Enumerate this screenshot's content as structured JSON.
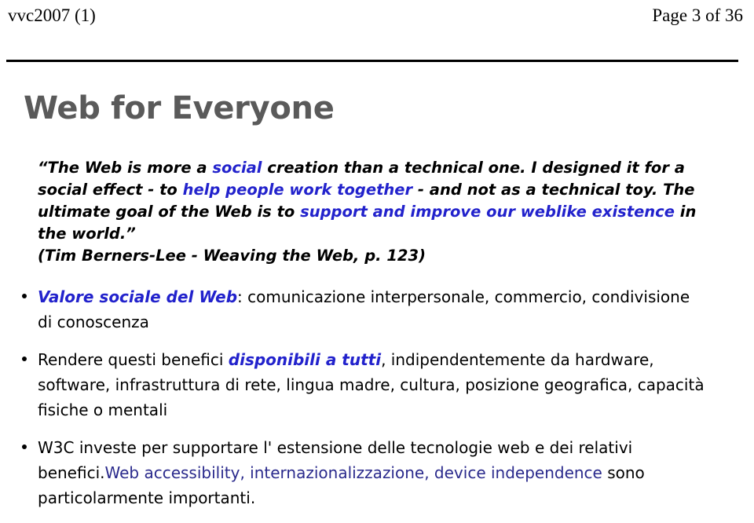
{
  "header": {
    "doc_id": "vvc2007 (1)",
    "page_label": "Page 3 of 36"
  },
  "slide": {
    "title": "Web for Everyone",
    "quote": {
      "seg1": "“The Web is more a ",
      "seg2_blue": "social",
      "seg3": " creation than a technical one. I designed it for a social effect - to ",
      "seg4_blue": "help people work together",
      "seg5": " - and not as a technical toy. The ultimate goal of the Web is to ",
      "seg6_blue": "support and improve our weblike existence",
      "seg7": " in the world.”",
      "attribution": "(Tim Berners-Lee - Weaving the Web, p. 123)"
    },
    "bullets": [
      {
        "lead_blue": "Valore sociale del Web",
        "rest": ": comunicazione interpersonale, commercio, condivisione di conoscenza"
      },
      {
        "pre": "Rendere questi benefici ",
        "mid_blue": "disponibili a tutti",
        "post": ", indipendentemente da hardware, software, infrastruttura di rete, lingua madre, cultura, posizione geografica, capacità fisiche o mentali"
      },
      {
        "pre": "W3C investe per supportare l' estensione delle tecnologie web e dei relativi benefici.",
        "mid_navy": "Web accessibility, internazionalizzazione, device independence",
        "post": " sono particolarmente importanti."
      }
    ]
  },
  "colors": {
    "title_gray": "#5a5a5a",
    "highlight_blue": "#2222cc",
    "navy_blue": "#2a2a8c",
    "text_black": "#000000",
    "background": "#ffffff"
  }
}
